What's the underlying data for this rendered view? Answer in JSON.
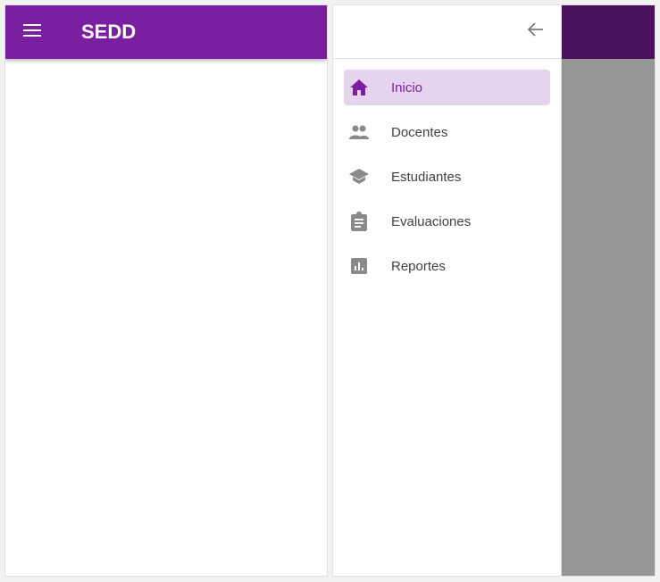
{
  "app": {
    "title": "SEDD"
  },
  "theme": {
    "brand": "#7b1fa2",
    "active_bg": "#e6d3ee",
    "scrim": "#969696"
  },
  "icons": {
    "menu": "menu-icon",
    "back": "arrow-back-icon"
  },
  "drawer": {
    "items": [
      {
        "label": "Inicio",
        "icon": "home-icon",
        "active": true
      },
      {
        "label": "Docentes",
        "icon": "people-icon",
        "active": false
      },
      {
        "label": "Estudiantes",
        "icon": "school-icon",
        "active": false
      },
      {
        "label": "Evaluaciones",
        "icon": "assignment-icon",
        "active": false
      },
      {
        "label": "Reportes",
        "icon": "bar-chart-icon",
        "active": false
      }
    ]
  }
}
